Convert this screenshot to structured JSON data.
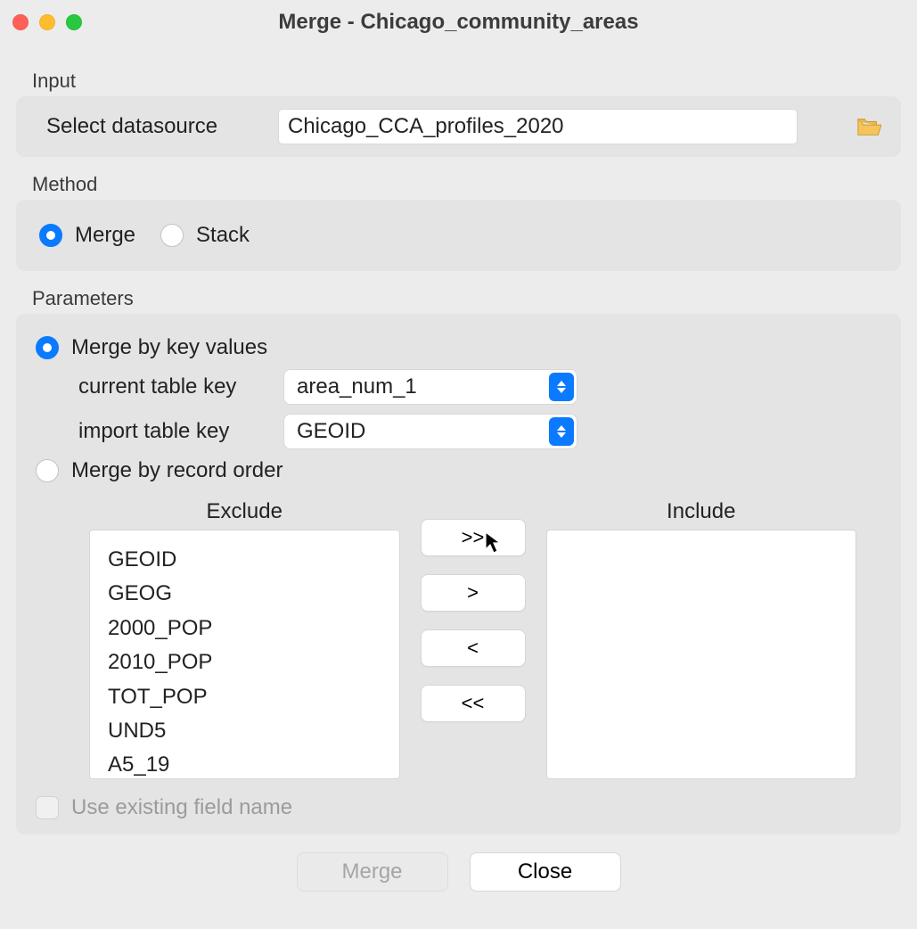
{
  "window": {
    "title": "Merge - Chicago_community_areas"
  },
  "sections": {
    "input_label": "Input",
    "method_label": "Method",
    "params_label": "Parameters"
  },
  "input": {
    "select_datasource_label": "Select datasource",
    "datasource_value": "Chicago_CCA_profiles_2020"
  },
  "method": {
    "merge_label": "Merge",
    "stack_label": "Stack",
    "selected": "merge"
  },
  "params": {
    "merge_by_key_label": "Merge by key values",
    "merge_by_order_label": "Merge by record order",
    "selected_mode": "by_key",
    "current_key_label": "current table key",
    "current_key_value": "area_num_1",
    "import_key_label": "import table key",
    "import_key_value": "GEOID",
    "exclude_header": "Exclude",
    "include_header": "Include",
    "exclude_items": [
      "GEOID",
      "GEOG",
      "2000_POP",
      "2010_POP",
      "TOT_POP",
      "UND5",
      "A5_19"
    ],
    "include_items": [],
    "move_all_right": ">>",
    "move_right": ">",
    "move_left": "<",
    "move_all_left": "<<",
    "use_existing_label": "Use existing field name",
    "use_existing_checked": false
  },
  "footer": {
    "merge_label": "Merge",
    "close_label": "Close",
    "merge_enabled": false
  }
}
